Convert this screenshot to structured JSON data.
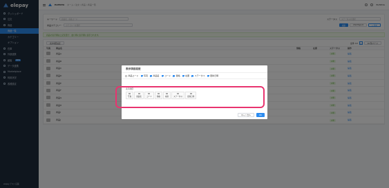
{
  "sidebar": {
    "logo": "elepay",
    "items": [
      {
        "label": "ダッシュボード",
        "icon": "dashboard-icon"
      },
      {
        "label": "注文",
        "icon": "order-icon"
      },
      {
        "label": "商品",
        "icon": "product-icon"
      },
      {
        "label": "商品一覧",
        "icon": "",
        "sub": true,
        "active": true
      },
      {
        "label": "カテゴリー",
        "icon": "",
        "sub": true
      },
      {
        "label": "オプション",
        "icon": "",
        "sub": true
      },
      {
        "label": "在庫",
        "icon": "stock-icon"
      },
      {
        "label": "外部連携",
        "icon": "link-icon"
      },
      {
        "label": "顧客",
        "icon": "customer-icon",
        "badge": "NEW"
      },
      {
        "label": "データ連携",
        "icon": "data-icon"
      },
      {
        "label": "Marketplace",
        "icon": "marketplace-icon"
      },
      {
        "label": "利用状況",
        "icon": "usage-icon"
      },
      {
        "label": "各種設定",
        "icon": "settings-icon"
      }
    ],
    "footer": "elepay テスト店舗"
  },
  "topbar": {
    "brand": "ELEPAYA",
    "breadcrumb": "ホーム / 注文 / 商品 / 商品一覧",
    "user": "ELEPAYA"
  },
  "filters": {
    "keyword_label": "キーワード",
    "keyword_placeholder": "商品名、商品コード",
    "category_label": "商品カテゴリー",
    "category_placeholder": "カテゴリーを選択",
    "status_label": "ステータス",
    "status_placeholder": "ステータスを選択",
    "search_button": "検索",
    "export_button": "CSV Export",
    "add_button": "+ 追加"
  },
  "alert": "商品の表示順は上記変更で、並び順に表示順に表示されます。",
  "table": {
    "toolbar_label": "表示項目設定",
    "headers": [
      "写真",
      "商品名",
      "",
      "価格",
      "在庫",
      "ステータス",
      "操作"
    ],
    "rows": [
      {
        "name": "商品A",
        "status": "公開",
        "action": "編集"
      },
      {
        "name": "商品B",
        "status": "公開",
        "action": "編集"
      },
      {
        "name": "商品C",
        "status": "公開",
        "action": "編集"
      },
      {
        "name": "商品D",
        "status": "公開",
        "action": "編集"
      },
      {
        "name": "商品E",
        "status": "公開",
        "action": "編集"
      },
      {
        "name": "商品F",
        "status": "公開",
        "action": "編集"
      },
      {
        "name": "商品G",
        "status": "公開",
        "action": "編集"
      },
      {
        "name": "商品H",
        "status": "公開",
        "action": "編集"
      },
      {
        "name": "商品I",
        "status": "公開",
        "action": "編集"
      },
      {
        "name": "商品J",
        "status": "公開",
        "action": "編集"
      }
    ],
    "total": "全件 10",
    "page": "1",
    "per_page": "10 件/ページ"
  },
  "modal": {
    "title": "表示項目設定",
    "checkboxes": [
      {
        "label": "商品コード",
        "checked": false
      },
      {
        "label": "写真",
        "checked": true
      },
      {
        "label": "商品名",
        "checked": true
      },
      {
        "label": "コード",
        "checked": true
      },
      {
        "label": "価格",
        "checked": true
      },
      {
        "label": "在庫",
        "checked": true
      },
      {
        "label": "ステータス",
        "checked": true
      },
      {
        "label": "更新日時",
        "checked": true
      }
    ],
    "order_label": "表示順序",
    "chips": [
      "写真",
      "商品名",
      "コード",
      "価格",
      "在庫",
      "ステータス",
      "更新日時"
    ],
    "cancel": "キャンセル",
    "ok": "OK"
  },
  "colors": {
    "accent": "#2d8cf0",
    "sidebar_bg": "#1f2d3d",
    "highlight": "#e8336f",
    "status_green": "#5fb336"
  }
}
